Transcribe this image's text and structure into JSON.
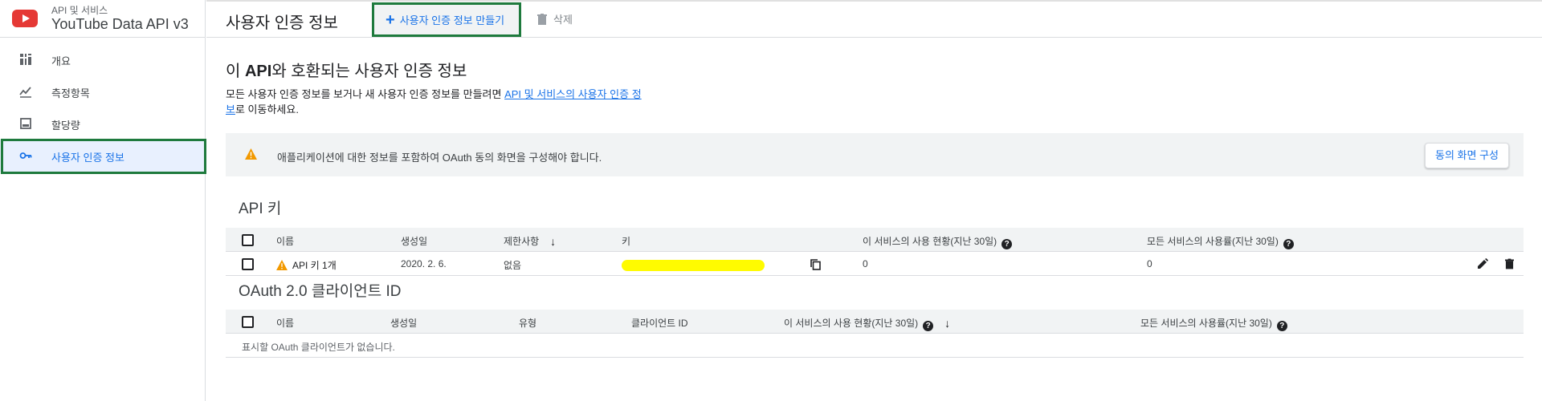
{
  "brand": {
    "subtitle": "API 및 서비스",
    "title": "YouTube Data API v3"
  },
  "sidebar": {
    "items": [
      {
        "label": "개요",
        "icon": "dashboard-icon"
      },
      {
        "label": "측정항목",
        "icon": "metrics-icon"
      },
      {
        "label": "할당량",
        "icon": "quota-icon"
      },
      {
        "label": "사용자 인증 정보",
        "icon": "key-icon",
        "active": true
      }
    ]
  },
  "topbar": {
    "title": "사용자 인증 정보",
    "create_label": "사용자 인증 정보 만들기",
    "delete_label": "삭제"
  },
  "main": {
    "heading_prefix": "이 ",
    "heading_bold": "API",
    "heading_suffix": "와 호환되는 사용자 인증 정보",
    "desc_text": "모든 사용자 인증 정보를 보거나 새 사용자 인증 정보를 만들려면 ",
    "desc_link": "API 및 서비스의 사용자 인증 정보",
    "desc_suffix": "로 이동하세요.",
    "notice_text": "애플리케이션에 대한 정보를 포함하여 OAuth 동의 화면을 구성해야 합니다.",
    "notice_button": "동의 화면 구성"
  },
  "api_keys": {
    "section_title": "API 키",
    "headers": {
      "name": "이름",
      "created": "생성일",
      "restrictions": "제한사항",
      "key": "키",
      "usage_service": "이 서비스의 사용 현황(지난 30일)",
      "usage_all": "모든 서비스의 사용률(지난 30일)"
    },
    "rows": [
      {
        "name": "API 키 1개",
        "created": "2020. 2. 6.",
        "restrictions": "없음",
        "usage_service": "0",
        "usage_all": "0"
      }
    ]
  },
  "oauth": {
    "section_title": "OAuth 2.0 클라이언트 ID",
    "headers": {
      "name": "이름",
      "created": "생성일",
      "type": "유형",
      "client_id": "클라이언트 ID",
      "usage_service": "이 서비스의 사용 현황(지난 30일)",
      "usage_all": "모든 서비스의 사용률(지난 30일)"
    },
    "empty_message": "표시할 OAuth 클라이언트가 없습니다."
  },
  "colors": {
    "accent": "#1a73e8",
    "highlight_border": "#1e7a3d",
    "redacted": "#fffb00",
    "warning": "#f29900"
  }
}
